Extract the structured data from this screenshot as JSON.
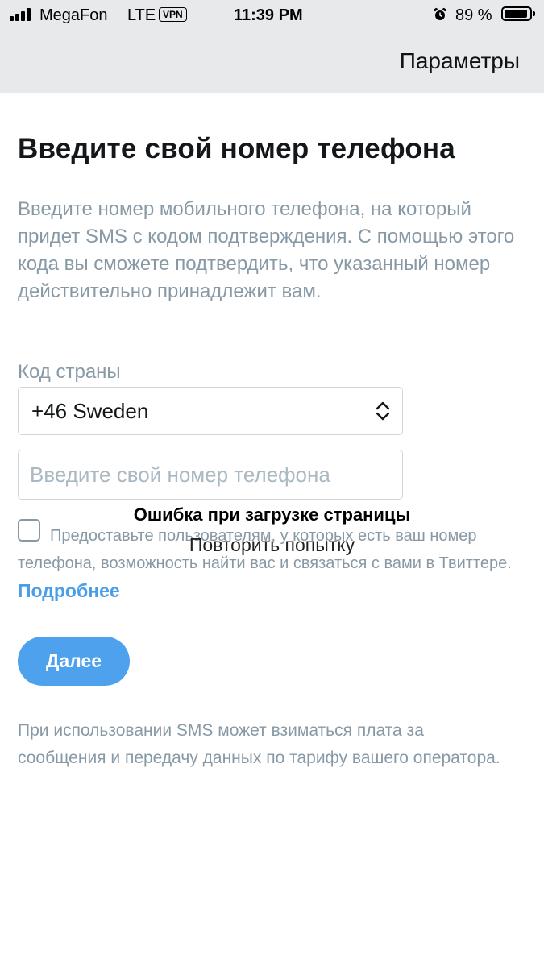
{
  "status_bar": {
    "carrier": "MegaFon",
    "network": "LTE",
    "vpn": "VPN",
    "time": "11:39 PM",
    "battery": "89 %"
  },
  "nav": {
    "settings_label": "Параметры"
  },
  "page": {
    "title": "Введите свой номер телефона",
    "description": "Введите номер мобильного телефона, на который придет SMS с кодом подтверждения. С помощью этого кода вы сможете подтвердить, что указанный номер действительно принадлежит вам."
  },
  "form": {
    "country_label": "Код страны",
    "country_value": "+46 Sweden",
    "phone_placeholder": "Введите свой номер телефона",
    "phone_value": "",
    "consent_text": "Предоставьте пользователям, у которых есть ваш номер телефона, возможность найти вас и связаться с вами в Твиттере.",
    "learn_more": "Подробнее",
    "next_label": "Далее"
  },
  "overlay": {
    "error_title": "Ошибка при загрузке страницы",
    "retry_label": "Повторить попытку"
  },
  "footer": {
    "sms_note": "При использовании SMS может взиматься плата за сообщения и передачу данных по тарифу вашего оператора."
  },
  "colors": {
    "accent": "#4ea1ed",
    "muted_text": "#8899a6",
    "title_text": "#14171a",
    "topbar": "#e8e9ea"
  }
}
